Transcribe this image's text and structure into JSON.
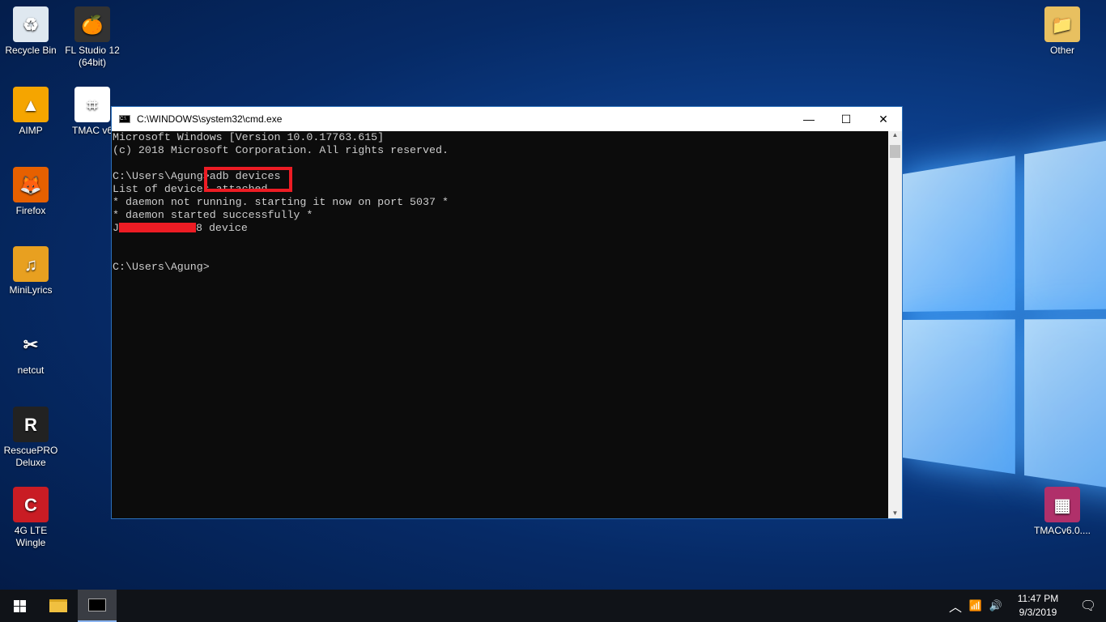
{
  "desktop": {
    "left_icons": [
      {
        "label": "Recycle Bin",
        "glyph": "♻",
        "color": "#dfe8f0"
      },
      {
        "label": "FL Studio 12 (64bit)",
        "glyph": "🍊",
        "color": "#333"
      },
      {
        "label": "AIMP",
        "glyph": "▲",
        "color": "#f5a500"
      },
      {
        "label": "TMAC v6",
        "glyph": "⌗",
        "color": "#fff"
      },
      {
        "label": "Firefox",
        "glyph": "🦊",
        "color": "#e66000"
      },
      {
        "label": "MiniLyrics",
        "glyph": "♫",
        "color": "#e8a020"
      },
      {
        "label": "netcut",
        "glyph": "✂",
        "color": "transparent"
      },
      {
        "label": "RescuePRO Deluxe",
        "glyph": "R",
        "color": "#222"
      },
      {
        "label": "4G LTE Wingle",
        "glyph": "C",
        "color": "#c91c24"
      }
    ],
    "right_icons": [
      {
        "label": "Other",
        "glyph": "📁",
        "color": "#e8c060"
      },
      {
        "label": "TMACv6.0....",
        "glyph": "▦",
        "color": "#b0306a"
      }
    ]
  },
  "window": {
    "title": "C:\\WINDOWS\\system32\\cmd.exe",
    "minimize": "—",
    "maximize": "☐",
    "close": "✕",
    "lines": [
      "Microsoft Windows [Version 10.0.17763.615]",
      "(c) 2018 Microsoft Corporation. All rights reserved.",
      "",
      "C:\\Users\\Agung>adb devices",
      "List of devices attached",
      "* daemon not running. starting it now on port 5037 *",
      "* daemon started successfully *"
    ],
    "device_prefix": "J",
    "device_suffix": "8 device",
    "prompt": "C:\\Users\\Agung>",
    "highlight_color": "#ed1c24"
  },
  "taskbar": {
    "time": "11:47 PM",
    "date": "9/3/2019"
  }
}
